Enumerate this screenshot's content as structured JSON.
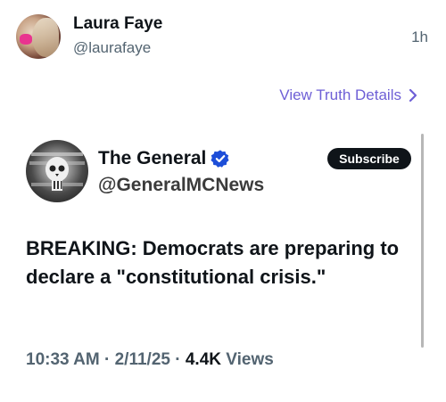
{
  "post": {
    "author_name": "Laura Faye",
    "author_handle": "@laurafaye",
    "time": "1h",
    "view_details": "View Truth Details",
    "avatar_icon": "profile-photo",
    "chevron_icon": "chevron-right-icon",
    "link_color": "#6e5fd6"
  },
  "embedded": {
    "name": "The General",
    "handle": "@GeneralMCNews",
    "verified_icon": "verified-badge-icon",
    "verified_color": "#1d4ed8",
    "subscribe_label": "Subscribe",
    "text": "BREAKING: Democrats are preparing to declare a \"constitutional crisis.\"",
    "time": "10:33 AM",
    "date": "2/11/25",
    "views_count": "4.4K",
    "views_label": "Views",
    "separator": "·"
  }
}
